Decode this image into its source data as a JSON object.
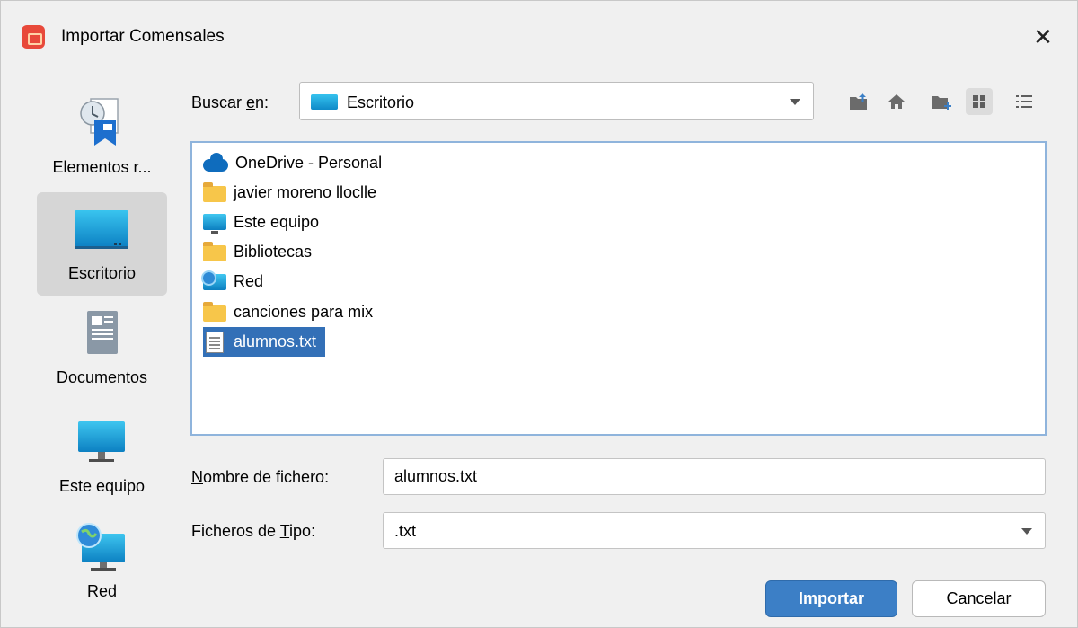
{
  "window": {
    "title": "Importar Comensales",
    "close_symbol": "✕"
  },
  "places": [
    {
      "label": "Elementos r...",
      "icon": "recent-items-icon"
    },
    {
      "label": "Escritorio",
      "icon": "desktop-icon",
      "selected": true
    },
    {
      "label": "Documentos",
      "icon": "documents-icon"
    },
    {
      "label": "Este equipo",
      "icon": "this-pc-icon"
    },
    {
      "label": "Red",
      "icon": "network-icon"
    }
  ],
  "toolbar": {
    "lookin_label_mnemonic_pre": "Buscar ",
    "lookin_label_mnemonic": "e",
    "lookin_label_mnemonic_post": "n:",
    "lookin_value": "Escritorio",
    "buttons": [
      "up-folder-icon",
      "home-icon",
      "new-folder-icon",
      "list-view-icon",
      "details-view-icon"
    ]
  },
  "files": [
    {
      "name": "OneDrive - Personal",
      "icon": "onedrive-icon"
    },
    {
      "name": "javier moreno lloclle",
      "icon": "folder-icon"
    },
    {
      "name": "Este equipo",
      "icon": "this-pc-icon"
    },
    {
      "name": "Bibliotecas",
      "icon": "folder-icon"
    },
    {
      "name": "Red",
      "icon": "network-icon"
    },
    {
      "name": "canciones para mix",
      "icon": "folder-icon"
    },
    {
      "name": "alumnos.txt",
      "icon": "text-file-icon",
      "selected": true
    }
  ],
  "form": {
    "filename_label_mnemonic": "N",
    "filename_label_rest": "ombre de fichero:",
    "filename_value": "alumnos.txt",
    "filetype_label_pre": "Ficheros de ",
    "filetype_label_mnemonic": "T",
    "filetype_label_post": "ipo:",
    "filetype_value": ".txt"
  },
  "actions": {
    "import_label": "Importar",
    "cancel_label": "Cancelar"
  },
  "colors": {
    "accent": "#3c7fc6",
    "selection": "#3370b7"
  }
}
